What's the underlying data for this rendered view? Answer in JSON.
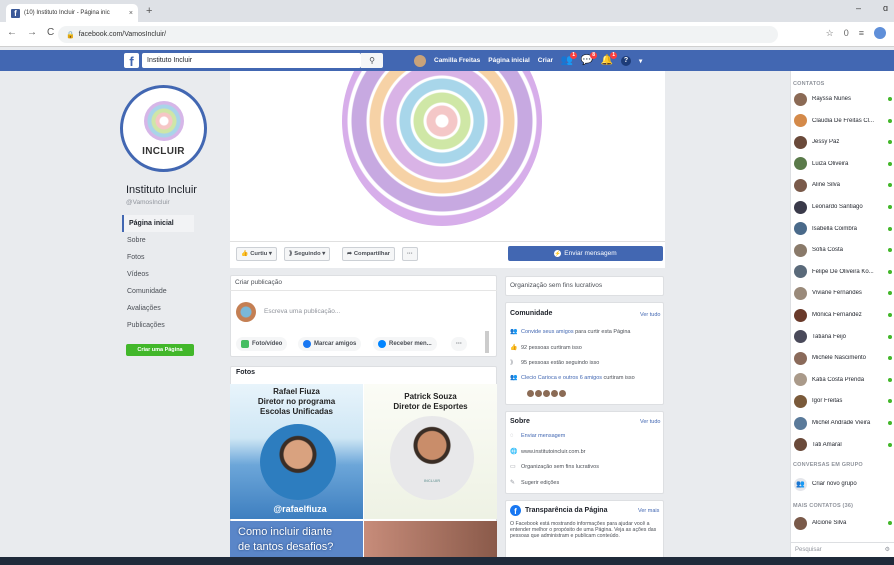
{
  "browser": {
    "tab_title": "(10) Instituto Incluir - Página inic",
    "tab_close": "×",
    "new_tab": "+",
    "url": "facebook.com/VamosIncluir/",
    "nav": {
      "back": "←",
      "forward": "→",
      "reload": "C"
    },
    "window": {
      "minimize": "–",
      "restore": "ɑ"
    },
    "icons": {
      "star": "☆",
      "ext": "0",
      "menu": "≡"
    }
  },
  "fb_bar": {
    "search_value": "Instituto Incluir",
    "search_icon": "⚲",
    "user": "Camilla Freitas",
    "home": "Página inicial",
    "create": "Criar",
    "badges": {
      "friends": "1",
      "messages": "8",
      "notifications": "1"
    },
    "help": "?",
    "caret": "▾"
  },
  "page": {
    "logo_text": "INCLUIR",
    "name": "Instituto Incluir",
    "handle": "@VamosIncluir",
    "left_nav": [
      {
        "label": "Página inicial",
        "active": true
      },
      {
        "label": "Sobre",
        "active": false
      },
      {
        "label": "Fotos",
        "active": false
      },
      {
        "label": "Vídeos",
        "active": false
      },
      {
        "label": "Comunidade",
        "active": false
      },
      {
        "label": "Avaliações",
        "active": false
      },
      {
        "label": "Publicações",
        "active": false
      }
    ],
    "create_page_button": "Criar uma Página"
  },
  "action_bar": {
    "curtiu": "Curtiu ▾",
    "seguindo": "Seguindo ▾",
    "compartilhar": "Compartilhar",
    "more": "···",
    "send_message": "Enviar mensagem"
  },
  "create_post": {
    "title": "Criar publicação",
    "placeholder": "Escreva uma publicação...",
    "buttons": [
      "Foto/vídeo",
      "Marcar amigos",
      "Receber men...",
      "···"
    ]
  },
  "photos": {
    "title": "Fotos",
    "photo1_text": "Rafael Fiuza\nDiretor no programa\nEscolas Unificadas",
    "photo2_text": "Patrick Souza\nDiretor de Esportes",
    "photo1_handle": "@rafaelfiuza",
    "photo3_text": "Como incluir diante\nde tantos desafios?",
    "photo2_shirt": "INCLUIR"
  },
  "org_card": {
    "text": "Organização sem fins lucrativos"
  },
  "community": {
    "title": "Comunidade",
    "see_all": "Ver tudo",
    "rows": [
      {
        "icon": "👥",
        "link": "Convide seus amigos",
        "text": " para curtir esta Página"
      },
      {
        "icon": "👍",
        "link": "",
        "text": "92 pessoas curtiram isso"
      },
      {
        "icon": "⟫",
        "link": "",
        "text": "95 pessoas estão seguindo isso"
      },
      {
        "icon": "👥",
        "link": "Clecio Carioca e outros 6 amigos",
        "text": " curtiram isso"
      }
    ]
  },
  "about": {
    "title": "Sobre",
    "see_all": "Ver tudo",
    "rows": [
      {
        "icon": "◌",
        "text": "Enviar mensagem",
        "link": true
      },
      {
        "icon": "🌐",
        "text": "www.institutoincluir.com.br",
        "link": false
      },
      {
        "icon": "▭",
        "text": "Organização sem fins lucrativos",
        "link": false
      },
      {
        "icon": "✎",
        "text": "Sugerir edições",
        "link": false
      }
    ]
  },
  "transparency": {
    "title": "Transparência da Página",
    "see_more": "Ver mais",
    "body": "O Facebook está mostrando informações para ajudar você a entender melhor o propósito de uma Página. Veja as ações das pessoas que administram e publicam conteúdo."
  },
  "contacts": {
    "header": "CONTATOS",
    "list": [
      {
        "name": "Rayssa Nunes",
        "color": "#8b6a55"
      },
      {
        "name": "Claudia De Freitas Cl...",
        "color": "#d48a4a"
      },
      {
        "name": "Jessy Paz",
        "color": "#6a4a3a"
      },
      {
        "name": "Luiza Oliveira",
        "color": "#5a7a4a"
      },
      {
        "name": "Aline Silva",
        "color": "#7a5a4a"
      },
      {
        "name": "Leonardo Santiago",
        "color": "#3a3a4a"
      },
      {
        "name": "Isabella Coimbra",
        "color": "#4a6a8a"
      },
      {
        "name": "Sofia Costa",
        "color": "#8a7a6a"
      },
      {
        "name": "Felipe De Oliveira Ko...",
        "color": "#5a6a7a"
      },
      {
        "name": "Viviane Fernandes",
        "color": "#9a8a7a"
      },
      {
        "name": "Mônica Fernandez",
        "color": "#6a3a2a"
      },
      {
        "name": "Tatiana Feijó",
        "color": "#4a4a5a"
      },
      {
        "name": "Michele Nascimento",
        "color": "#8a6a5a"
      },
      {
        "name": "Katia Costa Prenda",
        "color": "#aa9a8a"
      },
      {
        "name": "Igor Freitas",
        "color": "#7a5a3a"
      },
      {
        "name": "Michel Andrade Vieira",
        "color": "#5a7a9a"
      },
      {
        "name": "Tati Amaral",
        "color": "#6a4a3a"
      }
    ],
    "groups_header": "CONVERSAS EM GRUPO",
    "create_group": "Criar novo grupo",
    "more_header": "MAIS CONTATOS (36)",
    "more_list": [
      {
        "name": "Alcione Silva",
        "color": "#7a5a4a"
      }
    ],
    "search_placeholder": "Pesquisar"
  },
  "colors": {
    "fb_blue": "#4267b2",
    "online": "#42b72a",
    "green_button": "#42b72a"
  }
}
